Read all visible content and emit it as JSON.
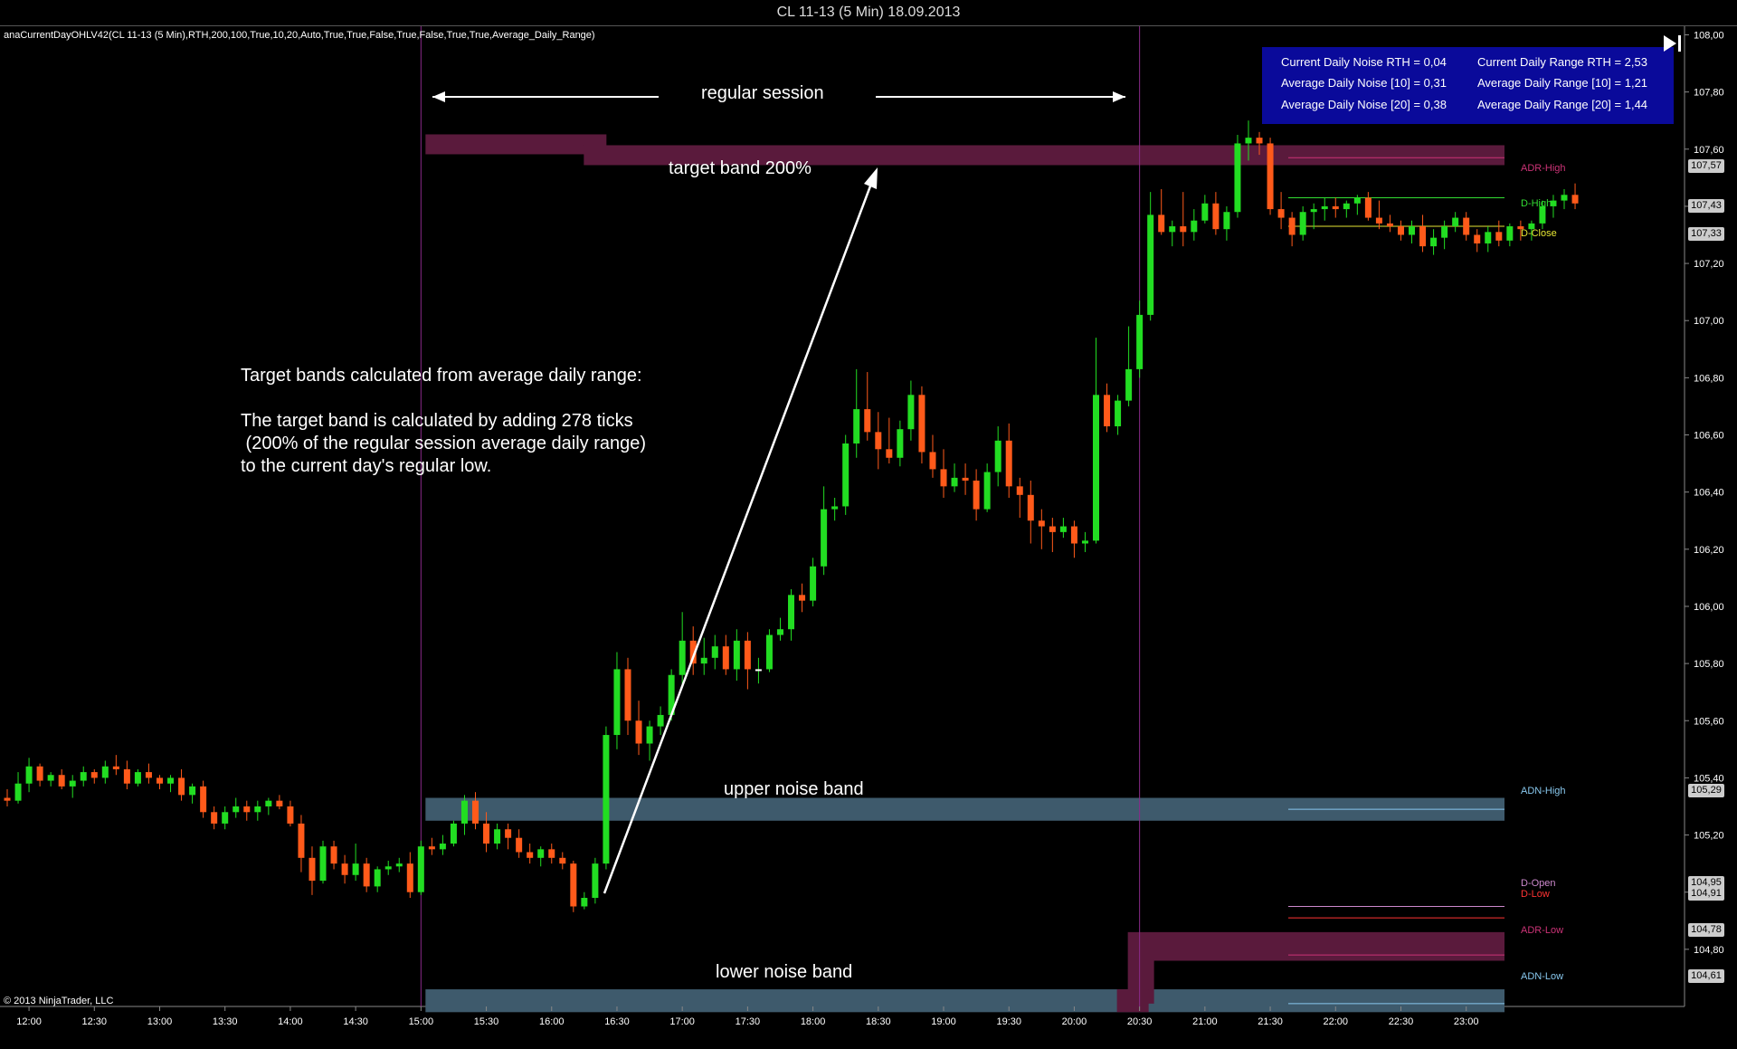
{
  "window_title": "CL 11-13 (5 Min)  18.09.2013",
  "indicator_label": "anaCurrentDayOHLV42(CL 11-13 (5 Min),RTH,200,100,True,10,20,Auto,True,True,False,True,False,True,True,Average_Daily_Range)",
  "copyright": "© 2013 NinjaTrader, LLC",
  "info_box": {
    "current_daily_noise": "Current Daily Noise RTH = 0,04",
    "avg_daily_noise_10": "Average Daily Noise [10] = 0,31",
    "avg_daily_noise_20": "Average Daily Noise [20] = 0,38",
    "current_daily_range": "Current Daily Range RTH = 2,53",
    "avg_daily_range_10": "Average Daily Range [10] = 1,21",
    "avg_daily_range_20": "Average Daily Range [20] = 1,44"
  },
  "annotations": {
    "regular_session": "regular session",
    "target_band": "target band 200%",
    "upper_noise_band": "upper noise band",
    "lower_noise_band": "lower noise band",
    "explanation": "Target bands calculated from average daily range:\n\nThe target band is calculated by adding 278 ticks\n (200% of the regular session average daily range)\nto the current day's regular low."
  },
  "line_labels": {
    "adr_high": "ADR-High",
    "d_high": "D-High",
    "d_close": "D-Close",
    "adn_high": "ADN-High",
    "d_open": "D-Open",
    "d_low": "D-Low",
    "adr_low": "ADR-Low",
    "adn_low": "ADN-Low"
  },
  "price_tags": {
    "adr_high": "107,57",
    "d_high": "107,43",
    "d_close": "107,33",
    "adn_high": "105,29",
    "d_open": "104,95",
    "d_low": "104,91",
    "adr_low": "104,78",
    "adn_low": "104,61"
  },
  "colors": {
    "background": "#000000",
    "bull": "#22dd22",
    "bear": "#ff5a1a",
    "target_band": "#5a1a3c",
    "noise_band": "#3e5a6c",
    "session_line": "#8a2a8a",
    "adr": "#cc3377",
    "d_high": "#33dd33",
    "d_close": "#e6e633",
    "adn": "#88c8ee",
    "d_open": "#cc88cc",
    "d_low": "#ff3333",
    "info_box": "#0a0a9a"
  },
  "chart_data": {
    "type": "candlestick",
    "instrument": "CL 11-13",
    "timeframe": "5 Min",
    "date": "18.09.2013",
    "y_ticks": [
      "104,80",
      "105,00",
      "105,20",
      "105,40",
      "105,60",
      "105,80",
      "106,00",
      "106,20",
      "106,40",
      "106,60",
      "106,80",
      "107,00",
      "107,20",
      "107,40",
      "107,60",
      "107,80",
      "108,00"
    ],
    "x_ticks": [
      "12:00",
      "12:30",
      "13:00",
      "13:30",
      "14:00",
      "14:30",
      "15:00",
      "15:30",
      "16:00",
      "16:30",
      "17:00",
      "17:30",
      "18:00",
      "18:30",
      "19:00",
      "19:30",
      "20:00",
      "20:30",
      "21:00",
      "21:30",
      "22:00",
      "22:30",
      "23:00"
    ],
    "x_start": "11:50",
    "bar_minutes": 5,
    "ylim": [
      104.6,
      108.03
    ],
    "session": {
      "start": "15:00",
      "end": "20:30"
    },
    "levels": {
      "adr_high": 107.57,
      "d_high": 107.43,
      "d_close": 107.33,
      "adn_high": 105.29,
      "d_open": 104.95,
      "d_low": 104.91,
      "adr_low": 104.78,
      "adn_low": 104.61
    },
    "target_band": [
      107.55,
      107.62
    ],
    "upper_noise_band": [
      105.25,
      105.33
    ],
    "lower_noise_band": [
      104.58,
      104.66
    ],
    "ohlc": [
      [
        105.33,
        105.36,
        105.3,
        105.32
      ],
      [
        105.32,
        105.42,
        105.31,
        105.38
      ],
      [
        105.38,
        105.47,
        105.35,
        105.44
      ],
      [
        105.44,
        105.45,
        105.37,
        105.39
      ],
      [
        105.39,
        105.42,
        105.37,
        105.41
      ],
      [
        105.41,
        105.43,
        105.36,
        105.37
      ],
      [
        105.37,
        105.41,
        105.33,
        105.39
      ],
      [
        105.39,
        105.44,
        105.37,
        105.42
      ],
      [
        105.42,
        105.43,
        105.38,
        105.4
      ],
      [
        105.4,
        105.46,
        105.38,
        105.44
      ],
      [
        105.44,
        105.48,
        105.41,
        105.43
      ],
      [
        105.43,
        105.46,
        105.36,
        105.38
      ],
      [
        105.38,
        105.43,
        105.37,
        105.42
      ],
      [
        105.42,
        105.45,
        105.38,
        105.4
      ],
      [
        105.4,
        105.41,
        105.36,
        105.38
      ],
      [
        105.38,
        105.41,
        105.35,
        105.4
      ],
      [
        105.4,
        105.43,
        105.32,
        105.34
      ],
      [
        105.34,
        105.38,
        105.31,
        105.37
      ],
      [
        105.37,
        105.39,
        105.26,
        105.28
      ],
      [
        105.28,
        105.3,
        105.22,
        105.24
      ],
      [
        105.24,
        105.3,
        105.22,
        105.28
      ],
      [
        105.28,
        105.33,
        105.26,
        105.3
      ],
      [
        105.3,
        105.32,
        105.25,
        105.28
      ],
      [
        105.28,
        105.32,
        105.25,
        105.3
      ],
      [
        105.3,
        105.33,
        105.27,
        105.32
      ],
      [
        105.32,
        105.34,
        105.29,
        105.3
      ],
      [
        105.3,
        105.32,
        105.23,
        105.24
      ],
      [
        105.24,
        105.27,
        105.07,
        105.12
      ],
      [
        105.12,
        105.16,
        104.99,
        105.04
      ],
      [
        105.04,
        105.18,
        105.03,
        105.16
      ],
      [
        105.16,
        105.18,
        105.08,
        105.1
      ],
      [
        105.1,
        105.13,
        105.03,
        105.06
      ],
      [
        105.06,
        105.17,
        105.04,
        105.1
      ],
      [
        105.1,
        105.12,
        105.0,
        105.02
      ],
      [
        105.02,
        105.09,
        105.0,
        105.08
      ],
      [
        105.08,
        105.11,
        105.06,
        105.09
      ],
      [
        105.09,
        105.12,
        105.07,
        105.1
      ],
      [
        105.1,
        105.14,
        104.98,
        105.0
      ],
      [
        105.0,
        105.18,
        104.99,
        105.16
      ],
      [
        105.16,
        105.19,
        105.13,
        105.15
      ],
      [
        105.15,
        105.2,
        105.13,
        105.17
      ],
      [
        105.17,
        105.25,
        105.16,
        105.24
      ],
      [
        105.24,
        105.34,
        105.2,
        105.32
      ],
      [
        105.32,
        105.35,
        105.22,
        105.24
      ],
      [
        105.24,
        105.28,
        105.14,
        105.17
      ],
      [
        105.17,
        105.24,
        105.15,
        105.22
      ],
      [
        105.22,
        105.24,
        105.15,
        105.19
      ],
      [
        105.19,
        105.22,
        105.12,
        105.14
      ],
      [
        105.14,
        105.17,
        105.1,
        105.12
      ],
      [
        105.12,
        105.16,
        105.09,
        105.15
      ],
      [
        105.15,
        105.17,
        105.1,
        105.12
      ],
      [
        105.12,
        105.14,
        105.08,
        105.1
      ],
      [
        105.1,
        105.11,
        104.93,
        104.95
      ],
      [
        104.95,
        105.0,
        104.94,
        104.98
      ],
      [
        104.98,
        105.12,
        104.96,
        105.1
      ],
      [
        105.1,
        105.58,
        105.08,
        105.55
      ],
      [
        105.55,
        105.84,
        105.5,
        105.78
      ],
      [
        105.78,
        105.82,
        105.55,
        105.6
      ],
      [
        105.6,
        105.67,
        105.48,
        105.52
      ],
      [
        105.52,
        105.6,
        105.46,
        105.58
      ],
      [
        105.58,
        105.65,
        105.55,
        105.62
      ],
      [
        105.62,
        105.78,
        105.6,
        105.76
      ],
      [
        105.76,
        105.98,
        105.72,
        105.88
      ],
      [
        105.88,
        105.93,
        105.76,
        105.8
      ],
      [
        105.8,
        105.89,
        105.76,
        105.82
      ],
      [
        105.82,
        105.9,
        105.78,
        105.86
      ],
      [
        105.86,
        105.9,
        105.76,
        105.78
      ],
      [
        105.78,
        105.92,
        105.74,
        105.88
      ],
      [
        105.88,
        105.91,
        105.71,
        105.78
      ],
      [
        105.78,
        105.82,
        105.73,
        105.78
      ],
      [
        105.78,
        105.92,
        105.77,
        105.9
      ],
      [
        105.9,
        105.96,
        105.88,
        105.92
      ],
      [
        105.92,
        106.06,
        105.88,
        106.04
      ],
      [
        106.04,
        106.08,
        105.98,
        106.02
      ],
      [
        106.02,
        106.17,
        106.0,
        106.14
      ],
      [
        106.14,
        106.42,
        106.11,
        106.34
      ],
      [
        106.34,
        106.38,
        106.3,
        106.35
      ],
      [
        106.35,
        106.6,
        106.32,
        106.57
      ],
      [
        106.57,
        106.83,
        106.52,
        106.69
      ],
      [
        106.69,
        106.82,
        106.58,
        106.61
      ],
      [
        106.61,
        106.68,
        106.48,
        106.55
      ],
      [
        106.55,
        106.66,
        106.5,
        106.52
      ],
      [
        106.52,
        106.65,
        106.49,
        106.62
      ],
      [
        106.62,
        106.79,
        106.58,
        106.74
      ],
      [
        106.74,
        106.77,
        106.5,
        106.54
      ],
      [
        106.54,
        106.6,
        106.45,
        106.48
      ],
      [
        106.48,
        106.55,
        106.38,
        106.42
      ],
      [
        106.42,
        106.5,
        106.4,
        106.45
      ],
      [
        106.45,
        106.5,
        106.39,
        106.44
      ],
      [
        106.44,
        106.48,
        106.3,
        106.34
      ],
      [
        106.34,
        106.5,
        106.33,
        106.47
      ],
      [
        106.47,
        106.63,
        106.42,
        106.58
      ],
      [
        106.58,
        106.64,
        106.38,
        106.42
      ],
      [
        106.42,
        106.45,
        106.31,
        106.39
      ],
      [
        106.39,
        106.44,
        106.22,
        106.3
      ],
      [
        106.3,
        106.34,
        106.2,
        106.28
      ],
      [
        106.28,
        106.31,
        106.19,
        106.26
      ],
      [
        106.26,
        106.31,
        106.24,
        106.28
      ],
      [
        106.28,
        106.3,
        106.17,
        106.22
      ],
      [
        106.22,
        106.26,
        106.19,
        106.23
      ],
      [
        106.23,
        106.94,
        106.22,
        106.74
      ],
      [
        106.74,
        106.78,
        106.61,
        106.63
      ],
      [
        106.63,
        106.74,
        106.6,
        106.72
      ],
      [
        106.72,
        106.98,
        106.7,
        106.83
      ],
      [
        106.83,
        107.07,
        106.8,
        107.02
      ],
      [
        107.02,
        107.45,
        107.0,
        107.37
      ],
      [
        107.37,
        107.46,
        107.3,
        107.31
      ],
      [
        107.31,
        107.35,
        107.26,
        107.33
      ],
      [
        107.33,
        107.45,
        107.26,
        107.31
      ],
      [
        107.31,
        107.39,
        107.28,
        107.35
      ],
      [
        107.35,
        107.44,
        107.34,
        107.41
      ],
      [
        107.41,
        107.45,
        107.3,
        107.32
      ],
      [
        107.32,
        107.4,
        107.28,
        107.38
      ],
      [
        107.38,
        107.65,
        107.36,
        107.62
      ],
      [
        107.62,
        107.7,
        107.56,
        107.64
      ],
      [
        107.64,
        107.66,
        107.58,
        107.62
      ],
      [
        107.62,
        107.64,
        107.37,
        107.39
      ],
      [
        107.39,
        107.45,
        107.32,
        107.36
      ],
      [
        107.36,
        107.38,
        107.26,
        107.3
      ],
      [
        107.3,
        107.4,
        107.28,
        107.38
      ],
      [
        107.38,
        107.41,
        107.32,
        107.39
      ],
      [
        107.39,
        107.43,
        107.35,
        107.4
      ],
      [
        107.4,
        107.43,
        107.36,
        107.39
      ],
      [
        107.39,
        107.42,
        107.36,
        107.41
      ],
      [
        107.41,
        107.44,
        107.37,
        107.43
      ],
      [
        107.43,
        107.45,
        107.35,
        107.36
      ],
      [
        107.36,
        107.42,
        107.32,
        107.34
      ],
      [
        107.34,
        107.37,
        107.31,
        107.33
      ],
      [
        107.33,
        107.35,
        107.28,
        107.3
      ],
      [
        107.3,
        107.35,
        107.27,
        107.33
      ],
      [
        107.33,
        107.37,
        107.24,
        107.26
      ],
      [
        107.26,
        107.32,
        107.23,
        107.29
      ],
      [
        107.29,
        107.35,
        107.25,
        107.33
      ],
      [
        107.33,
        107.38,
        107.31,
        107.36
      ],
      [
        107.36,
        107.38,
        107.28,
        107.3
      ],
      [
        107.3,
        107.32,
        107.24,
        107.27
      ],
      [
        107.27,
        107.33,
        107.24,
        107.31
      ],
      [
        107.31,
        107.35,
        107.26,
        107.28
      ],
      [
        107.28,
        107.34,
        107.26,
        107.33
      ],
      [
        107.33,
        107.35,
        107.28,
        107.32
      ],
      [
        107.32,
        107.35,
        107.28,
        107.34
      ],
      [
        107.34,
        107.42,
        107.32,
        107.4
      ],
      [
        107.4,
        107.44,
        107.36,
        107.42
      ],
      [
        107.42,
        107.46,
        107.39,
        107.44
      ],
      [
        107.44,
        107.48,
        107.39,
        107.41
      ]
    ]
  }
}
